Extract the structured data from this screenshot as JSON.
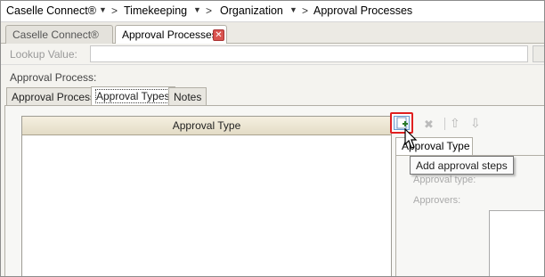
{
  "breadcrumb": {
    "items": [
      "Caselle Connect®",
      "Timekeeping",
      "Organization",
      "Approval Processes"
    ],
    "separator": ">"
  },
  "window_tabs": {
    "inactive_label": "Caselle Connect®",
    "active_label": "Approval Processes"
  },
  "lookup": {
    "label": "Lookup Value:",
    "value": ""
  },
  "approval_process_label": "Approval Process:",
  "inner_tabs": [
    "Approval Process",
    "Approval Types",
    "Notes"
  ],
  "grid": {
    "columns": [
      "Approval Type"
    ],
    "rows": []
  },
  "right_panel": {
    "tab_label": "Approval Type",
    "approval_type_label": "Approval type:",
    "approvers_label": "Approvers:"
  },
  "tooltip": "Add approval steps",
  "icons": {
    "add": "add-step-icon",
    "delete": "delete-icon",
    "move_up": "arrow-up-icon",
    "move_down": "arrow-down-icon",
    "close_tab": "close-icon"
  },
  "colors": {
    "highlight": "#e02020",
    "header_bg": "#ece5d0"
  }
}
